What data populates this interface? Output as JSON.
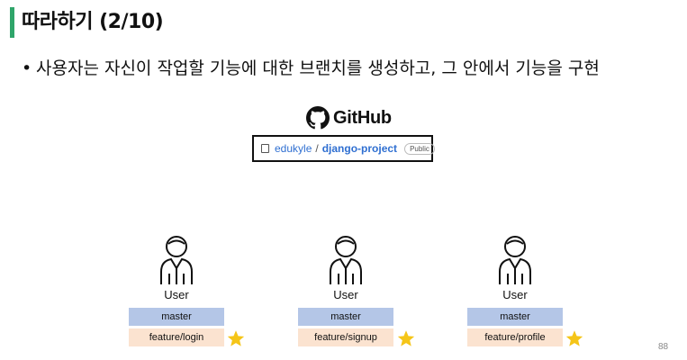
{
  "slide": {
    "title": "따라하기 (2/10)",
    "bullet": "사용자는 자신이 작업할 기능에 대한 브랜치를 생성하고, 그 안에서 기능을 구현",
    "page_number": "88"
  },
  "github": {
    "wordmark": "GitHub",
    "repo_owner": "edukyle",
    "repo_separator": "/",
    "repo_name": "django-project",
    "visibility_badge": "Public"
  },
  "users": [
    {
      "label": "User",
      "base_branch": "master",
      "feature_branch": "feature/login"
    },
    {
      "label": "User",
      "base_branch": "master",
      "feature_branch": "feature/signup"
    },
    {
      "label": "User",
      "base_branch": "master",
      "feature_branch": "feature/profile"
    }
  ],
  "colors": {
    "title_accent": "#2fa56a",
    "master_branch": "#b4c6e7",
    "feature_branch": "#fbe3d0",
    "star": "#f5c518",
    "repo_link": "#2f6fd1"
  }
}
